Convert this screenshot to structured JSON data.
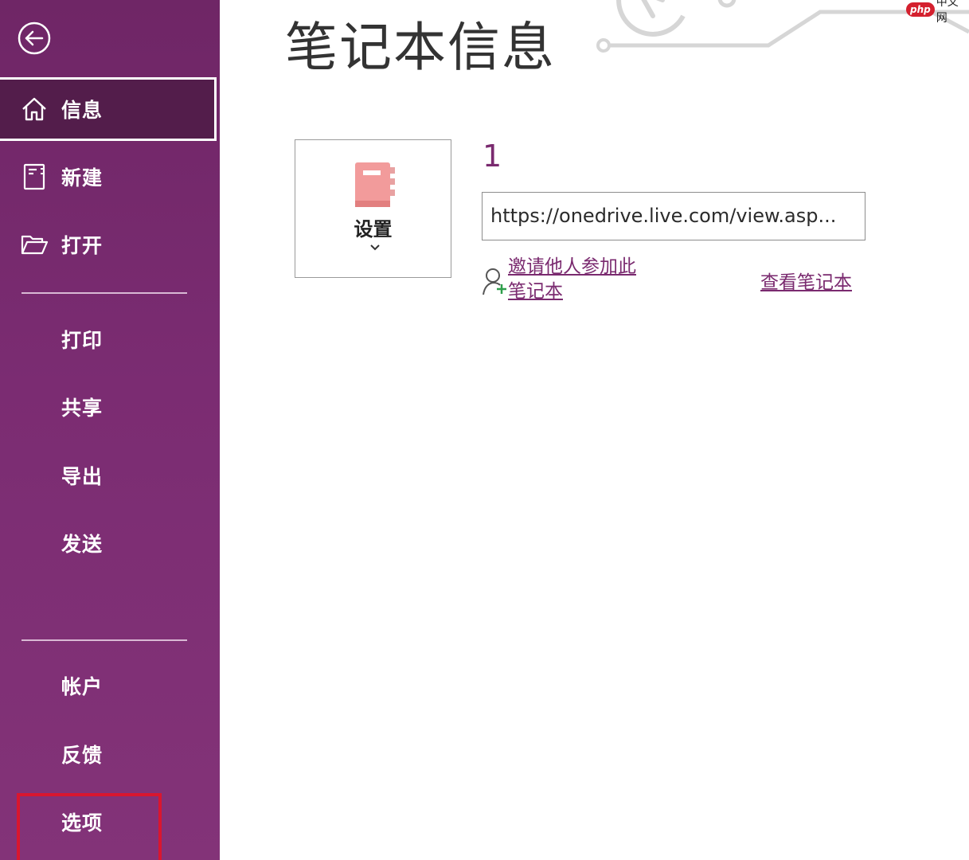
{
  "sidebar": {
    "items": [
      {
        "key": "info",
        "label": "信息",
        "icon": "home-icon",
        "active": true
      },
      {
        "key": "new",
        "label": "新建",
        "icon": "new-notebook-icon"
      },
      {
        "key": "open",
        "label": "打开",
        "icon": "folder-open-icon"
      },
      {
        "key": "print",
        "label": "打印"
      },
      {
        "key": "share",
        "label": "共享"
      },
      {
        "key": "export",
        "label": "导出"
      },
      {
        "key": "send",
        "label": "发送"
      },
      {
        "key": "account",
        "label": "帐户"
      },
      {
        "key": "feedback",
        "label": "反馈"
      },
      {
        "key": "options",
        "label": "选项",
        "highlighted": true
      }
    ],
    "back_icon": "back-arrow-icon"
  },
  "main": {
    "title": "笔记本信息",
    "settings": {
      "label": "设置",
      "icon": "notebook-icon",
      "chevron": "chevron-down-icon"
    },
    "notebook_name": "1",
    "url": "https://onedrive.live.com/view.asp...",
    "invite_link": "邀请他人参加此笔记本",
    "invite_icon": "add-person-icon",
    "view_link": "查看笔记本"
  },
  "watermark": {
    "badge": "php",
    "text": "中文网"
  },
  "colors": {
    "sidebar_bg": "#7b2c72",
    "sidebar_active": "#531d4b",
    "accent": "#7a2a6f",
    "highlight_border": "#d9162f",
    "notebook_icon": "#f29b9b"
  }
}
